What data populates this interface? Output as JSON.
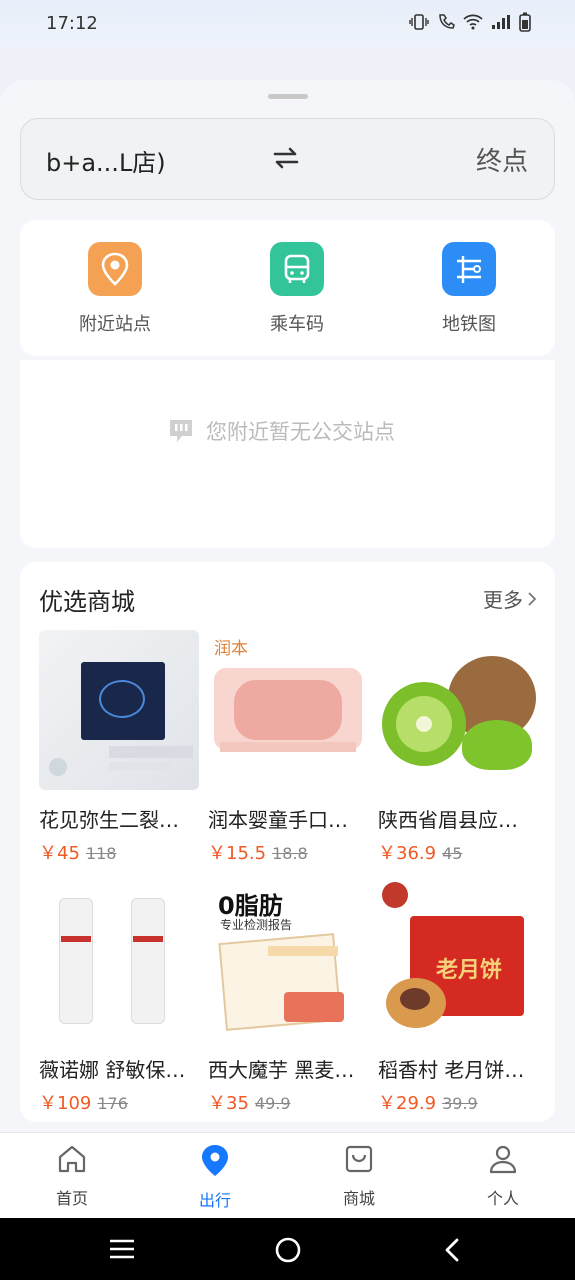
{
  "status": {
    "time": "17:12"
  },
  "route": {
    "from": "b+a...L店)",
    "to": "终点",
    "swap_icon": "swap-icon"
  },
  "quick_actions": [
    {
      "label": "附近站点",
      "icon": "location-pin-icon",
      "color": "#f5a154"
    },
    {
      "label": "乘车码",
      "icon": "bus-icon",
      "color": "#34c49a"
    },
    {
      "label": "地铁图",
      "icon": "metro-map-icon",
      "color": "#2b8df5"
    }
  ],
  "nearby": {
    "empty_text": "您附近暂无公交站点"
  },
  "mall": {
    "title": "优选商城",
    "more": "更多",
    "products": [
      {
        "name": "花见弥生二裂酵母精华面膜",
        "price": "￥45",
        "original": "118",
        "image": "face-mask-box"
      },
      {
        "name": "润本婴童手口湿巾",
        "price": "￥15.5",
        "original": "18.8",
        "image": "wet-wipes-pack",
        "brand_text": "润本"
      },
      {
        "name": "陕西省眉县应季猕猴桃",
        "price": "￥36.9",
        "original": "45",
        "image": "kiwi-fruit"
      },
      {
        "name": "薇诺娜 舒敏保湿特护霜",
        "price": "￥109",
        "original": "176",
        "image": "lotion-bottles"
      },
      {
        "name": "西大魔芋 黑麦代餐",
        "price": "￥35",
        "original": "49.9",
        "image": "diet-snack-report",
        "brand_text": "0脂肪",
        "sub_text": "专业检测报告"
      },
      {
        "name": "稻香村 老月饼礼盒",
        "price": "￥29.9",
        "original": "39.9",
        "image": "mooncake-box",
        "brand_text": "老月饼"
      }
    ]
  },
  "tabs": [
    {
      "label": "首页",
      "icon": "home-icon",
      "active": false
    },
    {
      "label": "出行",
      "icon": "location-pin-icon",
      "active": true
    },
    {
      "label": "商城",
      "icon": "shopping-bag-icon",
      "active": false
    },
    {
      "label": "个人",
      "icon": "person-icon",
      "active": false
    }
  ],
  "colors": {
    "accent": "#1677ff",
    "price": "#f15a24"
  }
}
